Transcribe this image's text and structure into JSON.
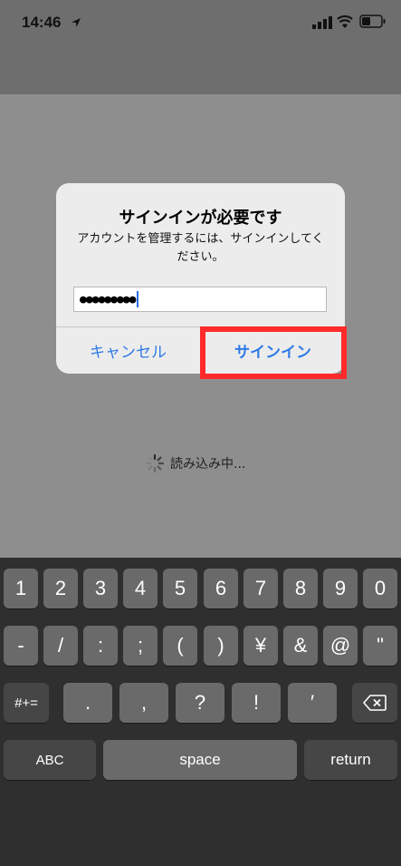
{
  "status_bar": {
    "time": "14:46"
  },
  "alert": {
    "title": "サインインが必要です",
    "message": "アカウントを管理するには、サインインしてください。",
    "password_value": "●●●●●●●●●",
    "cancel_label": "キャンセル",
    "signin_label": "サインイン"
  },
  "loading": {
    "text": "読み込み中..."
  },
  "keyboard": {
    "row1": [
      "1",
      "2",
      "3",
      "4",
      "5",
      "6",
      "7",
      "8",
      "9",
      "0"
    ],
    "row2": [
      "-",
      "/",
      ":",
      ";",
      "(",
      ")",
      "¥",
      "&",
      "@",
      "\""
    ],
    "row3": [
      "#+=",
      ".",
      ",",
      "?",
      "!",
      "′"
    ],
    "row4": [
      "ABC",
      "space",
      "return"
    ]
  },
  "colors": {
    "accent": "#2f7ae5",
    "highlight": "#ff2b2b"
  }
}
